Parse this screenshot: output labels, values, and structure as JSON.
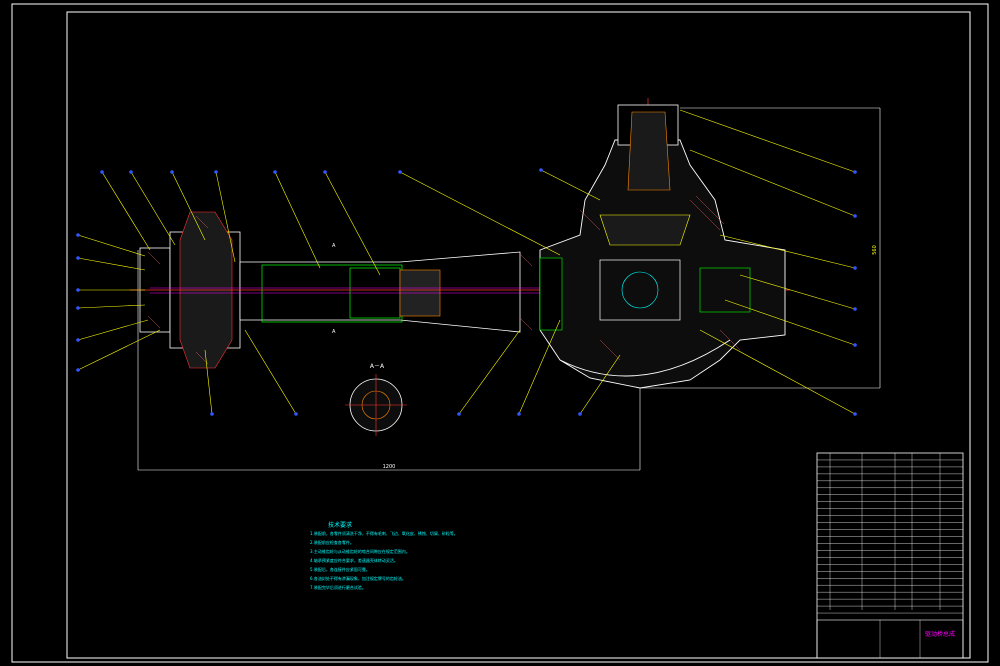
{
  "drawing": {
    "section_label": "A－A",
    "section_marks": [
      "A",
      "A"
    ],
    "dims": {
      "overall_length": "1200",
      "right_height": "560"
    },
    "notes_title": "技术要求",
    "notes": [
      "1.装配前，各零件须清洗干净，不得有毛刺、飞边、氧化皮、锈蚀、切屑、砂粒等。",
      "2.装配前应检查各零件。",
      "3.主动锥齿轮与从动锥齿轮的啮合间隙应在规定范围内。",
      "4.轴承预紧度应符合要求，差速器壳体转动灵活。",
      "5.装配后，各连接件应紧固可靠。",
      "6.各油封处不得有渗漏现象，加注规定牌号的齿轮油。",
      "7.装配完毕后须进行磨合试验。"
    ]
  },
  "title_block": {
    "title": "驱动桥总成",
    "rows": 24
  }
}
